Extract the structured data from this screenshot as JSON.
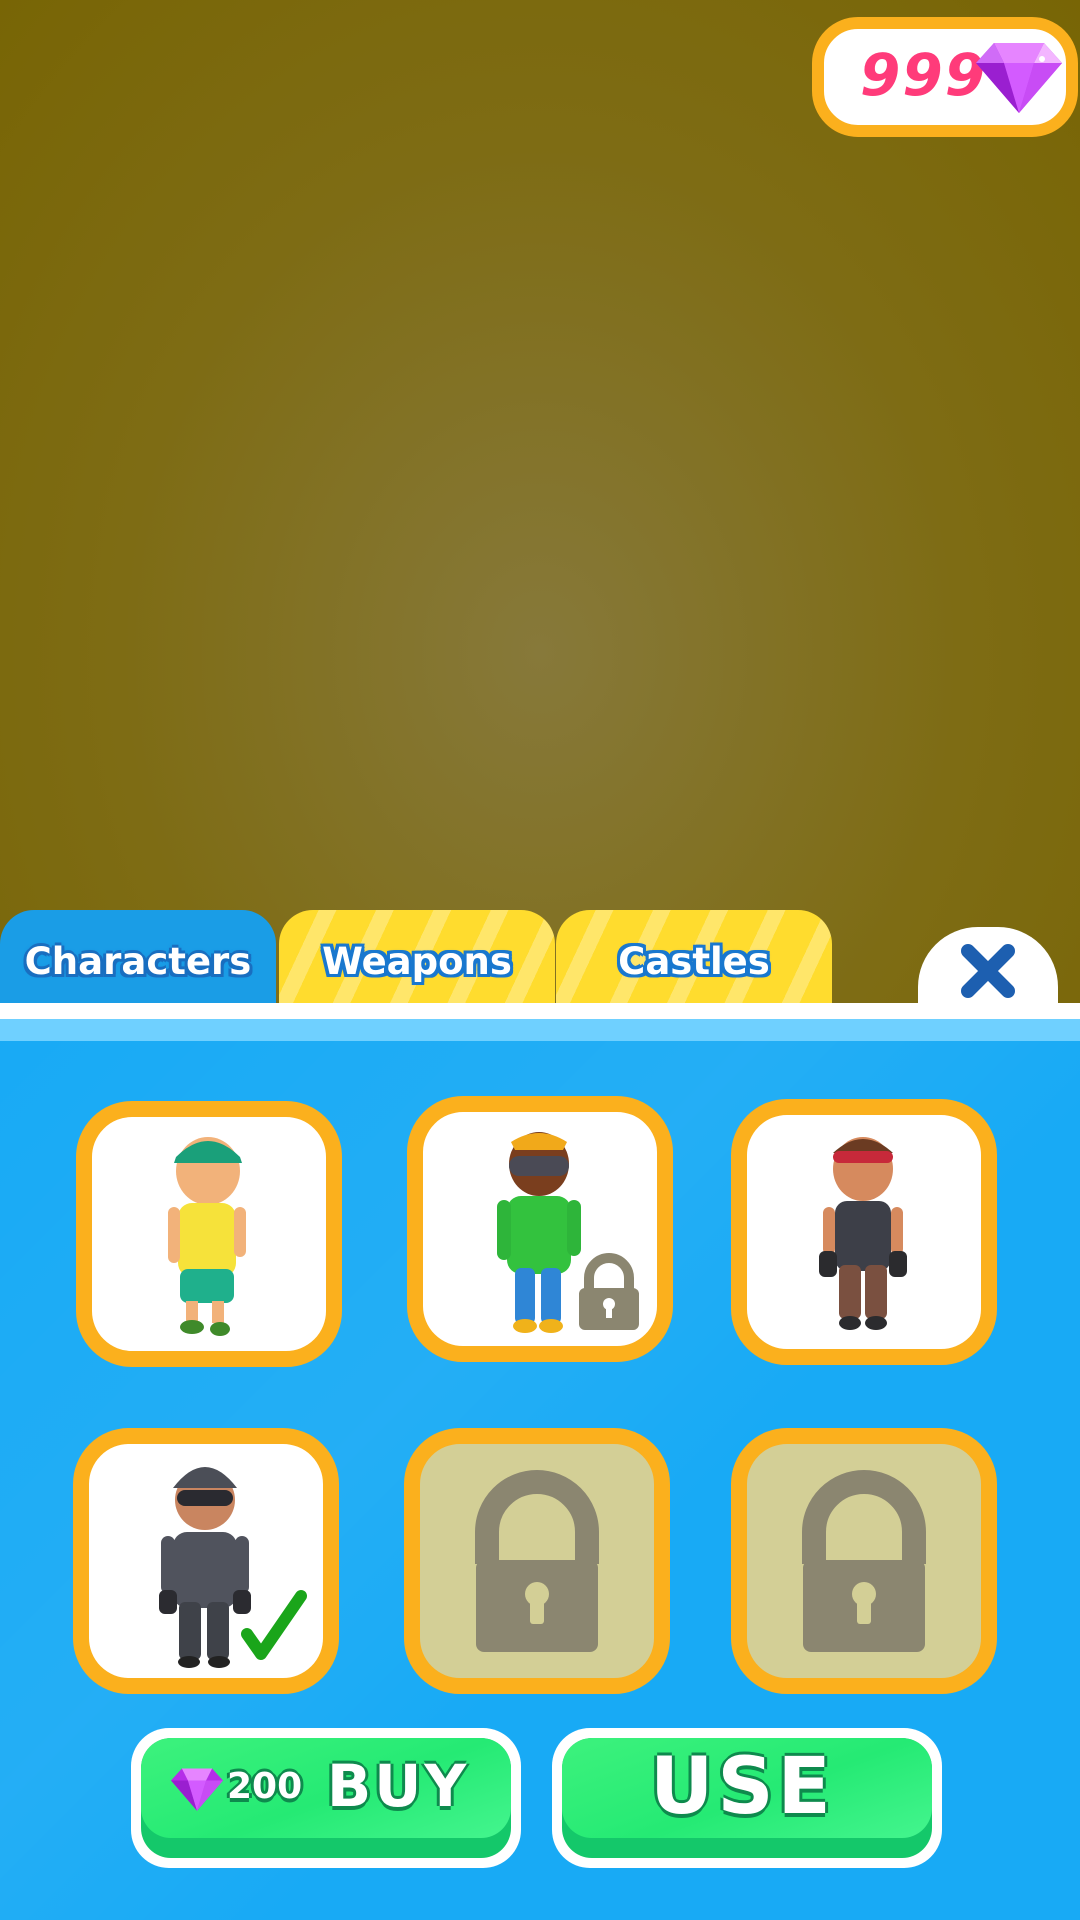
{
  "currency": {
    "gems": "999",
    "icon": "gem-icon",
    "color": "#ff3b7a"
  },
  "tabs": [
    {
      "label": "Characters",
      "active": true
    },
    {
      "label": "Weapons",
      "active": false
    },
    {
      "label": "Castles",
      "active": false
    }
  ],
  "close": {
    "icon": "close-icon"
  },
  "characters": [
    {
      "name": "yellow-shirt-cap",
      "locked": false,
      "selected": false
    },
    {
      "name": "green-shirt-visor",
      "locked": true,
      "selected": false
    },
    {
      "name": "headband-tank-top",
      "locked": false,
      "selected": false
    },
    {
      "name": "tactical-soldier",
      "locked": false,
      "selected": true
    },
    {
      "name": "locked-slot",
      "locked": true,
      "selected": false
    },
    {
      "name": "locked-slot",
      "locked": true,
      "selected": false
    }
  ],
  "actions": {
    "buy": {
      "price": "200",
      "label": "BUY"
    },
    "use": {
      "label": "USE"
    }
  },
  "colors": {
    "accent": "#fbb01d",
    "panel": "#18aaf5",
    "button": "#25ea74",
    "tab_active": "#1a9de6",
    "tab_inactive": "#ffdc2e"
  }
}
